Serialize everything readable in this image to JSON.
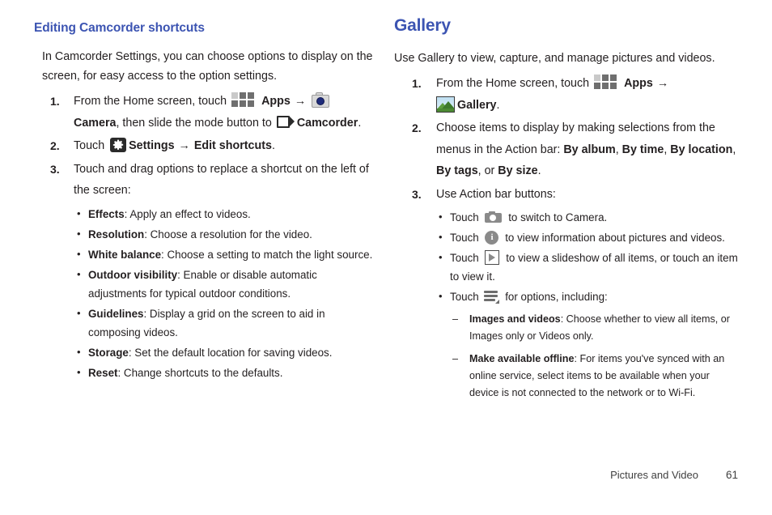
{
  "document": {
    "footer": {
      "chapter": "Pictures and Video",
      "page_number": "61"
    },
    "colors": {
      "heading": "#3c54b2",
      "body_text": "#231f20",
      "footer_text": "#3f3f3f"
    }
  },
  "left_column": {
    "heading": "Editing Camcorder shortcuts",
    "intro": "In Camcorder Settings, you can choose options to display on the screen, for easy access to the option settings.",
    "steps": [
      {
        "number": "1.",
        "part1": "From the Home screen, touch",
        "icon1": "apps-grid-icon",
        "label1": "Apps",
        "arrow": "→",
        "icon2": "camera-app-icon",
        "label2": "Camera",
        "part2": ", then slide the mode button to",
        "icon3": "camcorder-icon",
        "label3": "Camcorder",
        "part3": "."
      },
      {
        "number": "2.",
        "part1": "Touch",
        "icon1": "settings-gear-icon",
        "label1": "Settings",
        "arrow": "→",
        "label2": "Edit shortcuts",
        "part2": "."
      },
      {
        "number": "3.",
        "part1": "Touch and drag options to replace a shortcut on the left of the screen:"
      }
    ],
    "options": [
      {
        "term": "Effects",
        "desc": ": Apply an effect to videos."
      },
      {
        "term": "Resolution",
        "desc": ": Choose a resolution for the video."
      },
      {
        "term": "White balance",
        "desc": ": Choose a setting to match the light source."
      },
      {
        "term": "Outdoor visibility",
        "desc": ": Enable or disable automatic adjustments for typical outdoor conditions."
      },
      {
        "term": "Guidelines",
        "desc": ": Display a grid on the screen to aid in composing videos."
      },
      {
        "term": "Storage",
        "desc": ": Set the default location for saving videos."
      },
      {
        "term": "Reset",
        "desc": ": Change shortcuts to the defaults."
      }
    ]
  },
  "right_column": {
    "heading": "Gallery",
    "intro": "Use Gallery to view, capture, and manage pictures and videos.",
    "steps": [
      {
        "number": "1.",
        "part1": "From the Home screen, touch",
        "icon1": "apps-grid-icon",
        "label1": "Apps",
        "arrow": "→",
        "icon2": "gallery-app-icon",
        "label2": "Gallery",
        "part2": "."
      },
      {
        "number": "2.",
        "part1": "Choose items to display by making selections from the menus in the Action bar: ",
        "menu_options": [
          "By album",
          "By time",
          "By location",
          "By tags",
          "By size"
        ],
        "separator": ", ",
        "conjunction": ", or ",
        "part2": "."
      },
      {
        "number": "3.",
        "part1": "Use Action bar buttons:"
      }
    ],
    "action_buttons": [
      {
        "touch": "Touch",
        "icon": "camera-bar-icon",
        "desc": "to switch to Camera."
      },
      {
        "touch": "Touch",
        "icon": "info-icon",
        "desc": "to view information about pictures and videos."
      },
      {
        "touch": "Touch",
        "icon": "play-icon",
        "desc": "to view a slideshow of all items, or touch an item to view it."
      },
      {
        "touch": "Touch",
        "icon": "options-menu-icon",
        "desc": "for options, including:"
      }
    ],
    "menu_items": [
      {
        "term": "Images and videos",
        "desc": ": Choose whether to view all items, or Images only or Videos only."
      },
      {
        "term": "Make available offline",
        "desc": ": For items you've synced with an online service, select items to be available when your device is not connected to the network or to Wi-Fi."
      }
    ]
  }
}
